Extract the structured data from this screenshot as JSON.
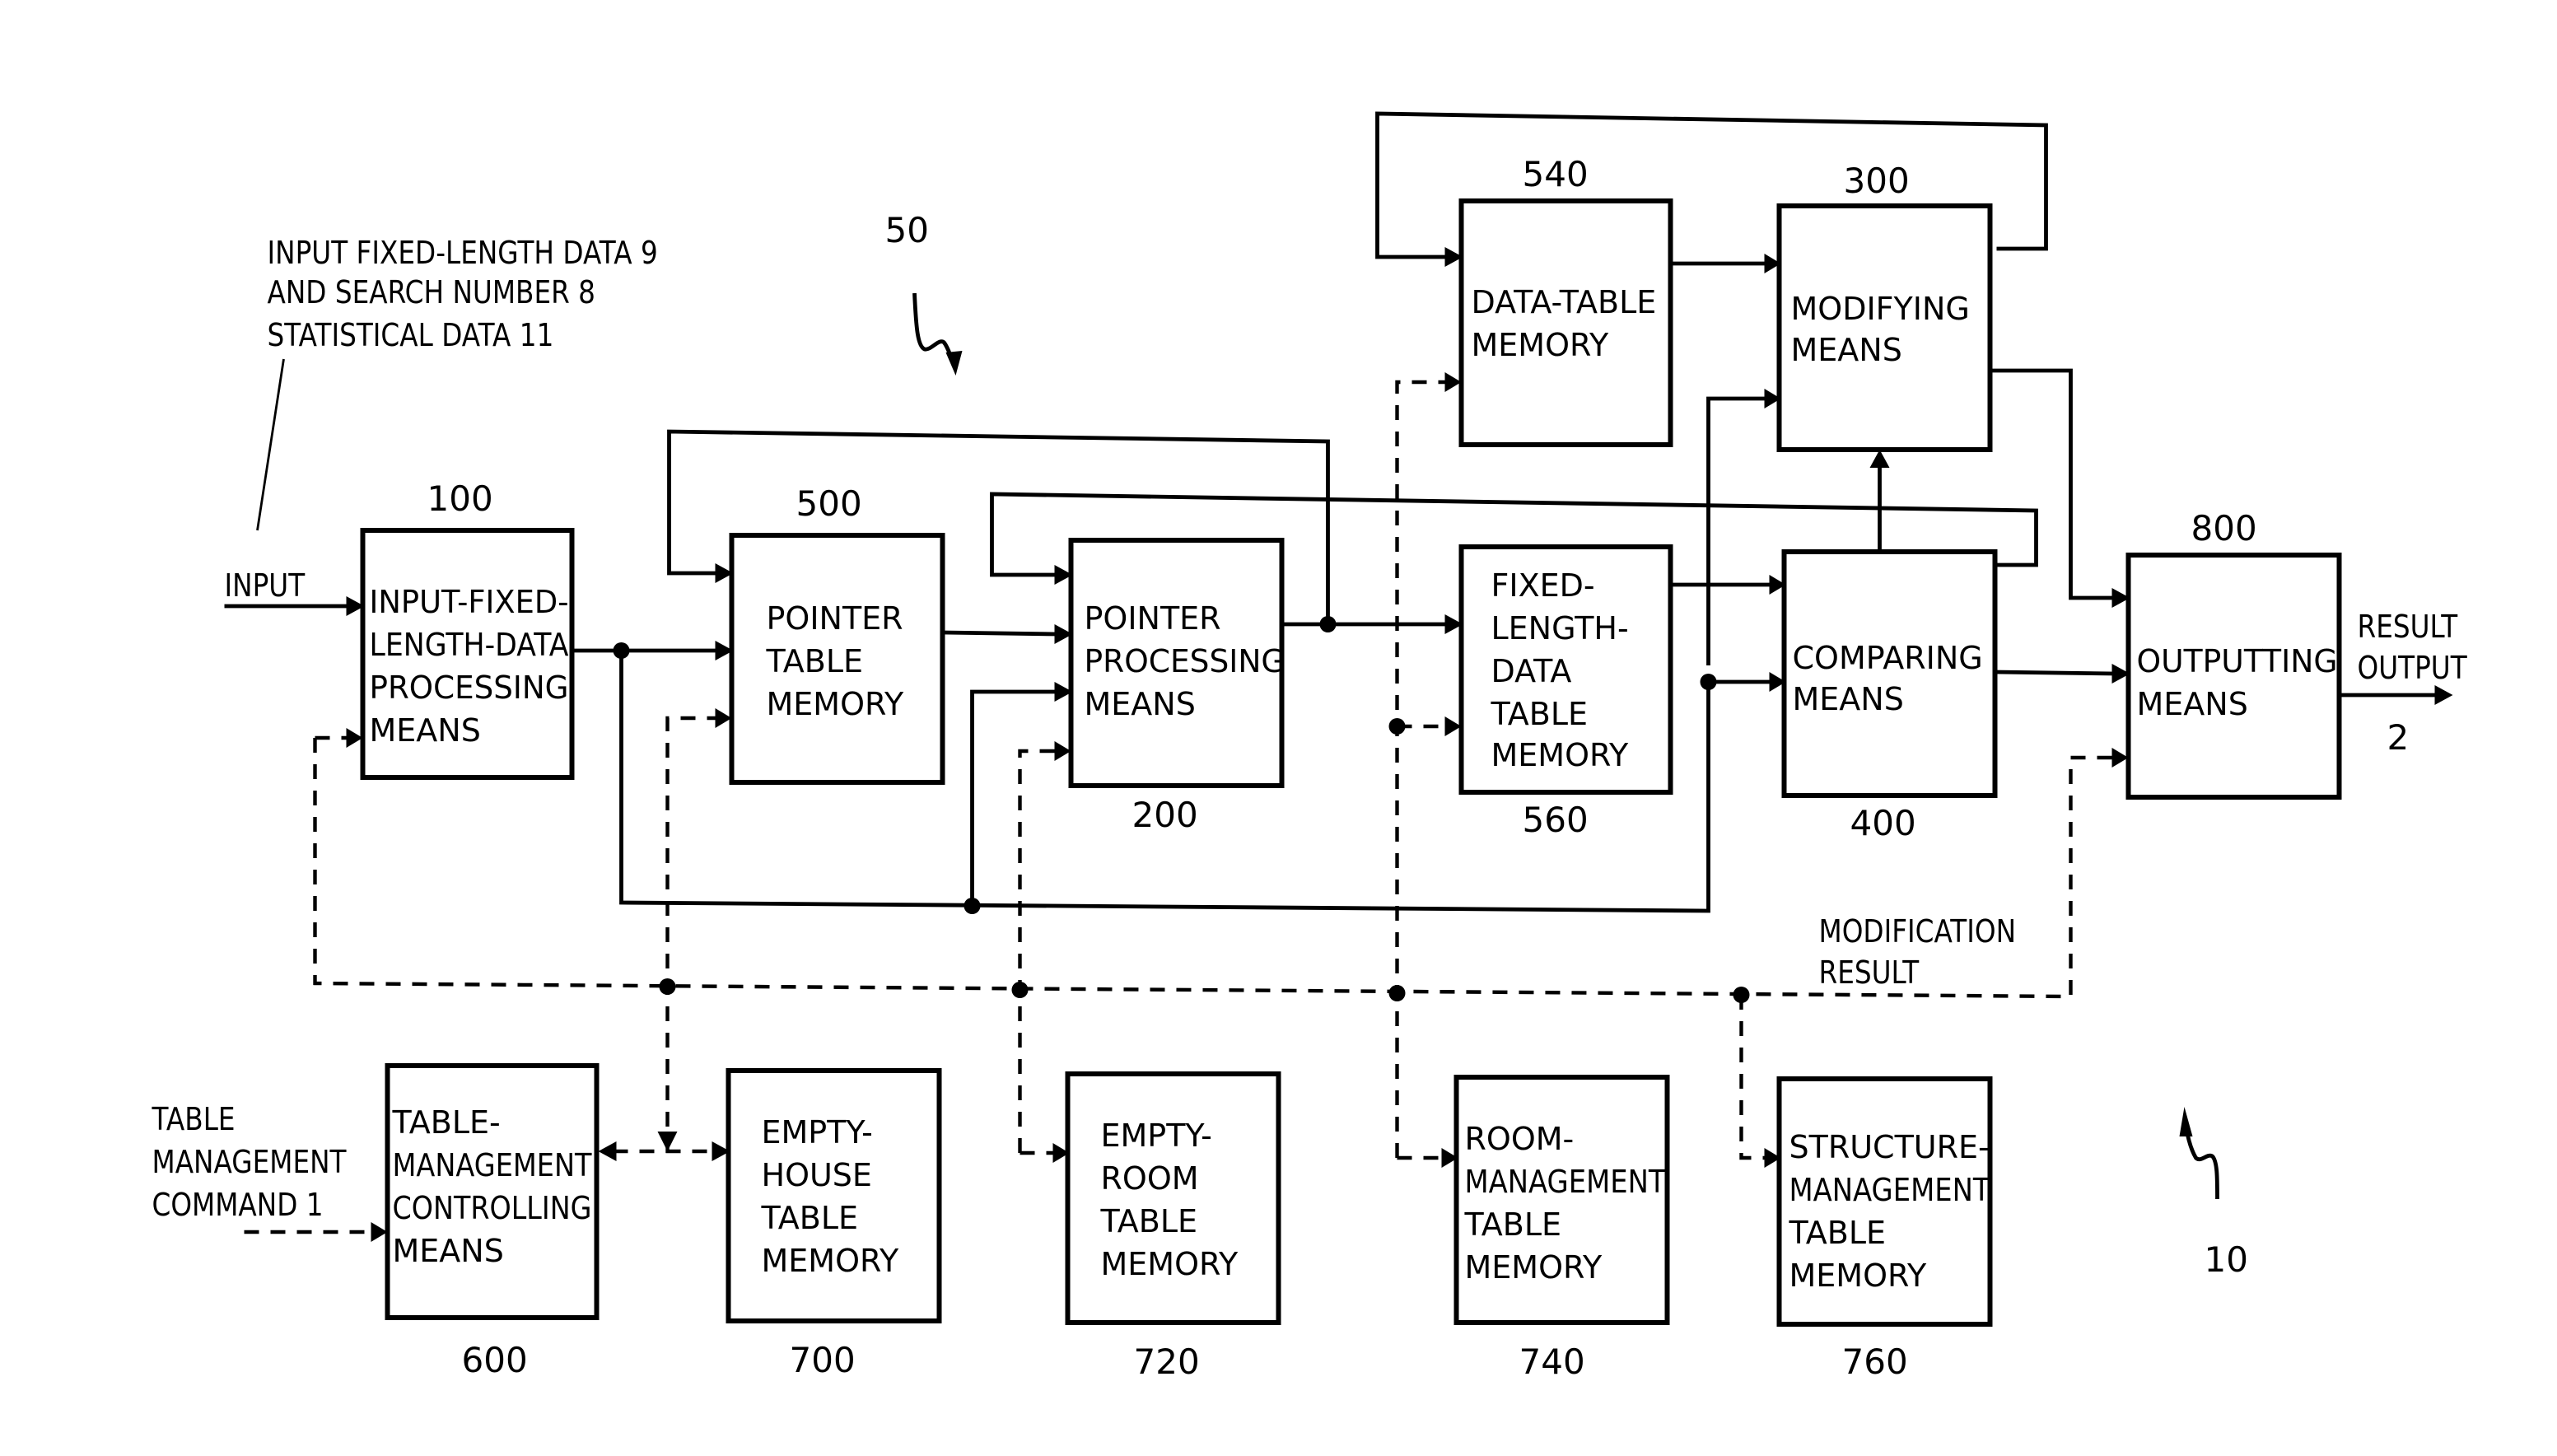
{
  "diagram": {
    "annotations": {
      "input_note": [
        "INPUT FIXED-LENGTH DATA 9",
        "AND SEARCH NUMBER 8",
        "STATISTICAL DATA 11"
      ],
      "input_label": "INPUT",
      "result_output": [
        "RESULT",
        "OUTPUT"
      ],
      "result_output_ref": "2",
      "modification_result": [
        "MODIFICATION",
        "RESULT"
      ],
      "table_management_command": [
        "TABLE",
        "MANAGEMENT",
        "COMMAND 1"
      ],
      "system_ref_50": "50",
      "system_ref_10": "10"
    },
    "blocks": [
      {
        "id": "100",
        "ref": "100",
        "lines": [
          "INPUT-FIXED-",
          "LENGTH-DATA",
          "PROCESSING",
          "MEANS"
        ]
      },
      {
        "id": "500",
        "ref": "500",
        "lines": [
          "POINTER",
          "TABLE",
          "MEMORY"
        ]
      },
      {
        "id": "200",
        "ref": "200",
        "lines": [
          "POINTER",
          "PROCESSING",
          "MEANS"
        ]
      },
      {
        "id": "540",
        "ref": "540",
        "lines": [
          "DATA-TABLE",
          "MEMORY"
        ]
      },
      {
        "id": "300",
        "ref": "300",
        "lines": [
          "MODIFYING",
          "MEANS"
        ]
      },
      {
        "id": "560",
        "ref": "560",
        "lines": [
          "FIXED-",
          "LENGTH-",
          "DATA",
          "TABLE",
          "MEMORY"
        ]
      },
      {
        "id": "400",
        "ref": "400",
        "lines": [
          "COMPARING",
          "MEANS"
        ]
      },
      {
        "id": "800",
        "ref": "800",
        "lines": [
          "OUTPUTTING",
          "MEANS"
        ]
      },
      {
        "id": "600",
        "ref": "600",
        "lines": [
          "TABLE-",
          "MANAGEMENT",
          "CONTROLLING",
          "MEANS"
        ]
      },
      {
        "id": "700",
        "ref": "700",
        "lines": [
          "EMPTY-",
          "HOUSE",
          "TABLE",
          "MEMORY"
        ]
      },
      {
        "id": "720",
        "ref": "720",
        "lines": [
          "EMPTY-",
          "ROOM",
          "TABLE",
          "MEMORY"
        ]
      },
      {
        "id": "740",
        "ref": "740",
        "lines": [
          "ROOM-",
          "MANAGEMENT",
          "TABLE",
          "MEMORY"
        ]
      },
      {
        "id": "760",
        "ref": "760",
        "lines": [
          "STRUCTURE-",
          "MANAGEMENT",
          "TABLE",
          "MEMORY"
        ]
      }
    ]
  }
}
